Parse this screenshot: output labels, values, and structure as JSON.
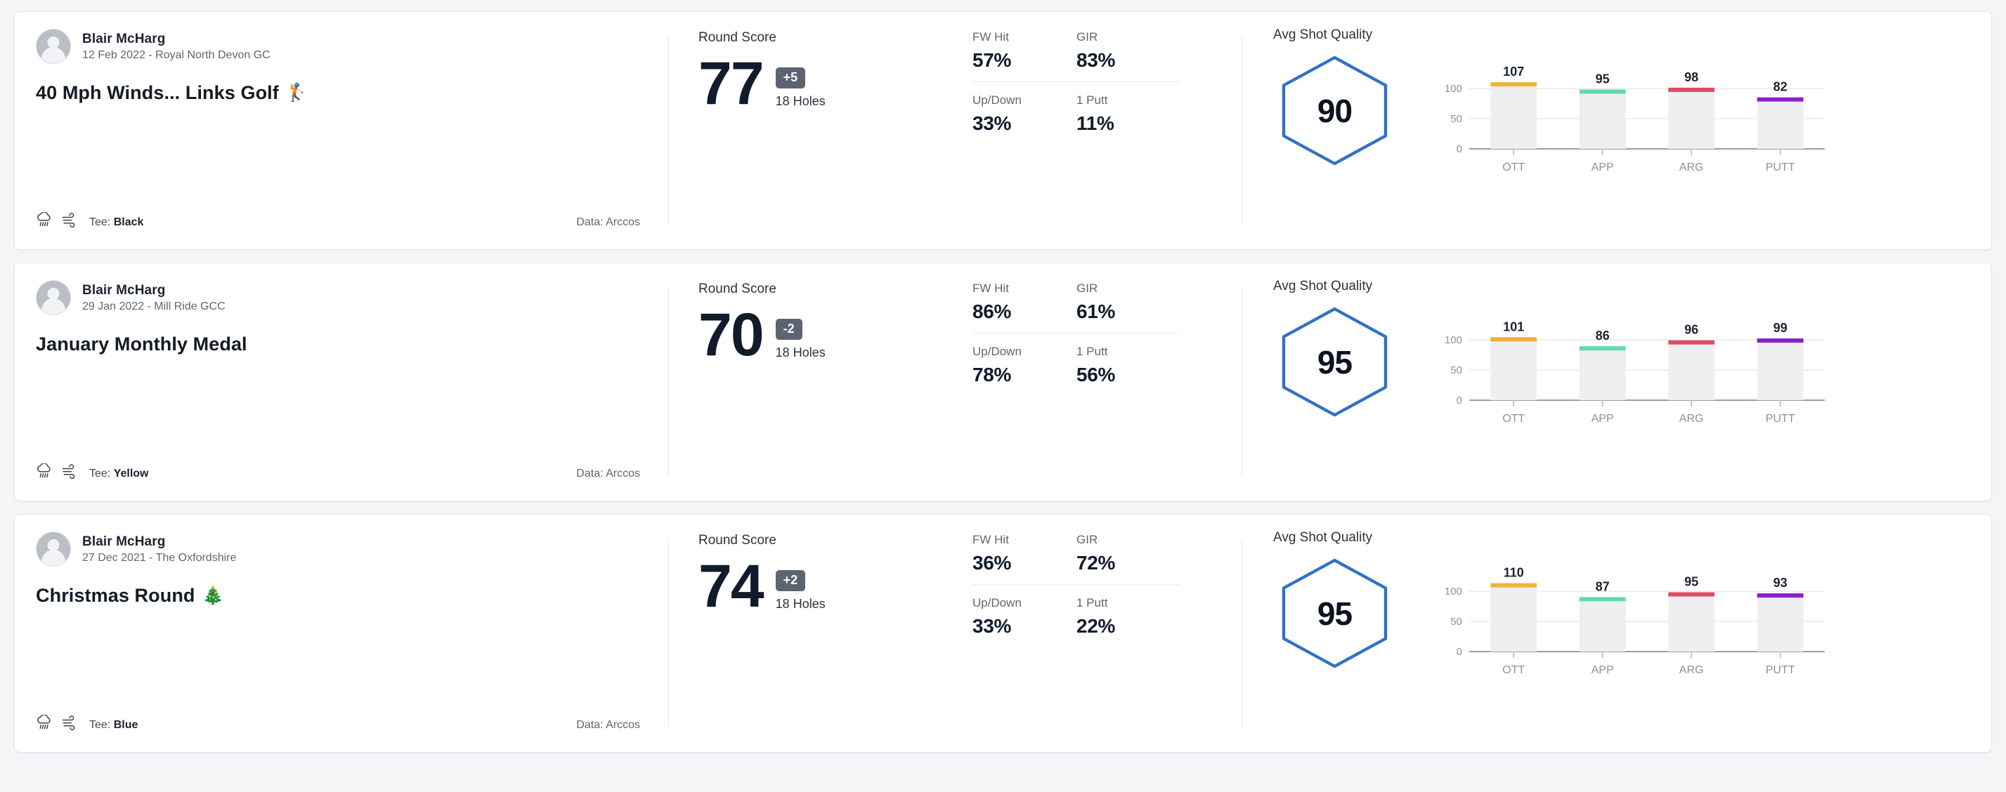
{
  "labels": {
    "round_score": "Round Score",
    "holes": "18 Holes",
    "avg_shot_quality": "Avg Shot Quality",
    "tee_prefix": "Tee:",
    "data_prefix": "Data:",
    "fw_hit": "FW Hit",
    "gir": "GIR",
    "up_down": "Up/Down",
    "one_putt": "1 Putt"
  },
  "colors": {
    "hexagon_stroke": "#2f72c4",
    "to_par_badge": "#5b6470",
    "ott": "#efb236",
    "app": "#63d7b2",
    "arg": "#e04a63",
    "putt": "#8b1fc9",
    "bar_background": "#eeeff0",
    "card_background": "#ffffff",
    "page_background": "#f4f5f7"
  },
  "rounds": [
    {
      "player": "Blair McHarg",
      "date_course": "12 Feb 2022 - Royal North Devon GC",
      "title": "40 Mph Winds... Links Golf",
      "title_emoji": "🏌️",
      "tee": "Black",
      "data_source": "Arccos",
      "weather_icons": [
        "rain-cloud-icon",
        "wind-icon"
      ],
      "score": "77",
      "to_par": "+5",
      "holes": "18 Holes",
      "stats": {
        "fw_hit": "57%",
        "gir": "83%",
        "up_down": "33%",
        "one_putt": "11%"
      },
      "shot_quality": "90",
      "chart_data": {
        "type": "bar",
        "title": "Avg Shot Quality",
        "categories": [
          "OTT",
          "APP",
          "ARG",
          "PUTT"
        ],
        "values": [
          107,
          95,
          98,
          82
        ],
        "colors": [
          "#efb236",
          "#63d7b2",
          "#e04a63",
          "#8b1fc9"
        ],
        "ylim": [
          0,
          120
        ],
        "yticks": [
          0,
          50,
          100
        ],
        "ylabel": "",
        "xlabel": "",
        "grid": true,
        "legend": "none"
      }
    },
    {
      "player": "Blair McHarg",
      "date_course": "29 Jan 2022 - Mill Ride GCC",
      "title": "January Monthly Medal",
      "title_emoji": "",
      "tee": "Yellow",
      "data_source": "Arccos",
      "weather_icons": [
        "rain-cloud-icon",
        "wind-icon"
      ],
      "score": "70",
      "to_par": "-2",
      "holes": "18 Holes",
      "stats": {
        "fw_hit": "86%",
        "gir": "61%",
        "up_down": "78%",
        "one_putt": "56%"
      },
      "shot_quality": "95",
      "chart_data": {
        "type": "bar",
        "title": "Avg Shot Quality",
        "categories": [
          "OTT",
          "APP",
          "ARG",
          "PUTT"
        ],
        "values": [
          101,
          86,
          96,
          99
        ],
        "colors": [
          "#efb236",
          "#63d7b2",
          "#e04a63",
          "#8b1fc9"
        ],
        "ylim": [
          0,
          120
        ],
        "yticks": [
          0,
          50,
          100
        ],
        "ylabel": "",
        "xlabel": "",
        "grid": true,
        "legend": "none"
      }
    },
    {
      "player": "Blair McHarg",
      "date_course": "27 Dec 2021 - The Oxfordshire",
      "title": "Christmas Round",
      "title_emoji": "🎄",
      "tee": "Blue",
      "data_source": "Arccos",
      "weather_icons": [
        "rain-cloud-icon",
        "wind-icon"
      ],
      "score": "74",
      "to_par": "+2",
      "holes": "18 Holes",
      "stats": {
        "fw_hit": "36%",
        "gir": "72%",
        "up_down": "33%",
        "one_putt": "22%"
      },
      "shot_quality": "95",
      "chart_data": {
        "type": "bar",
        "title": "Avg Shot Quality",
        "categories": [
          "OTT",
          "APP",
          "ARG",
          "PUTT"
        ],
        "values": [
          110,
          87,
          95,
          93
        ],
        "colors": [
          "#efb236",
          "#63d7b2",
          "#e04a63",
          "#8b1fc9"
        ],
        "ylim": [
          0,
          120
        ],
        "yticks": [
          0,
          50,
          100
        ],
        "ylabel": "",
        "xlabel": "",
        "grid": true,
        "legend": "none"
      }
    }
  ]
}
